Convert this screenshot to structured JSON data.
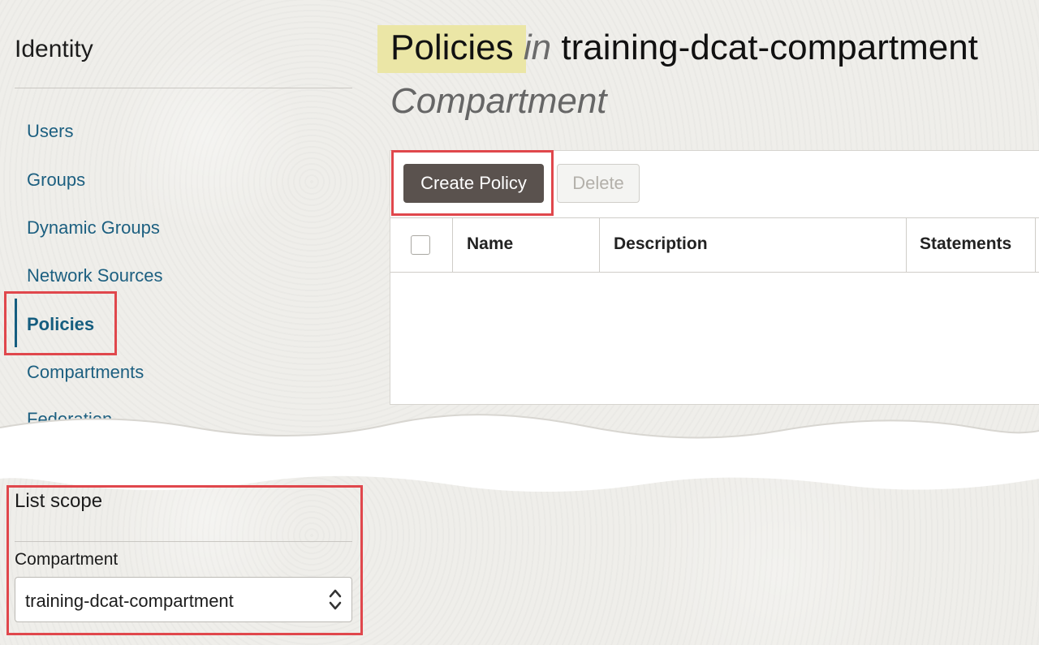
{
  "sidebar": {
    "title": "Identity",
    "items": [
      {
        "label": "Users"
      },
      {
        "label": "Groups"
      },
      {
        "label": "Dynamic Groups"
      },
      {
        "label": "Network Sources"
      },
      {
        "label": "Policies",
        "active": true
      },
      {
        "label": "Compartments"
      },
      {
        "label": "Federation"
      }
    ]
  },
  "header": {
    "title_main": "Policies",
    "title_in": "in",
    "title_compartment": "training-dcat-compartment",
    "subtitle": "Compartment"
  },
  "toolbar": {
    "create_label": "Create Policy",
    "delete_label": "Delete"
  },
  "table": {
    "columns": [
      "Name",
      "Description",
      "Statements"
    ]
  },
  "list_scope": {
    "title": "List scope",
    "compartment_label": "Compartment",
    "compartment_value": "training-dcat-compartment"
  },
  "colors": {
    "nav_link": "#1c5f80",
    "primary_button": "#5a524e",
    "highlight": "#ebe6a6",
    "annotation_red": "#e0474c"
  }
}
